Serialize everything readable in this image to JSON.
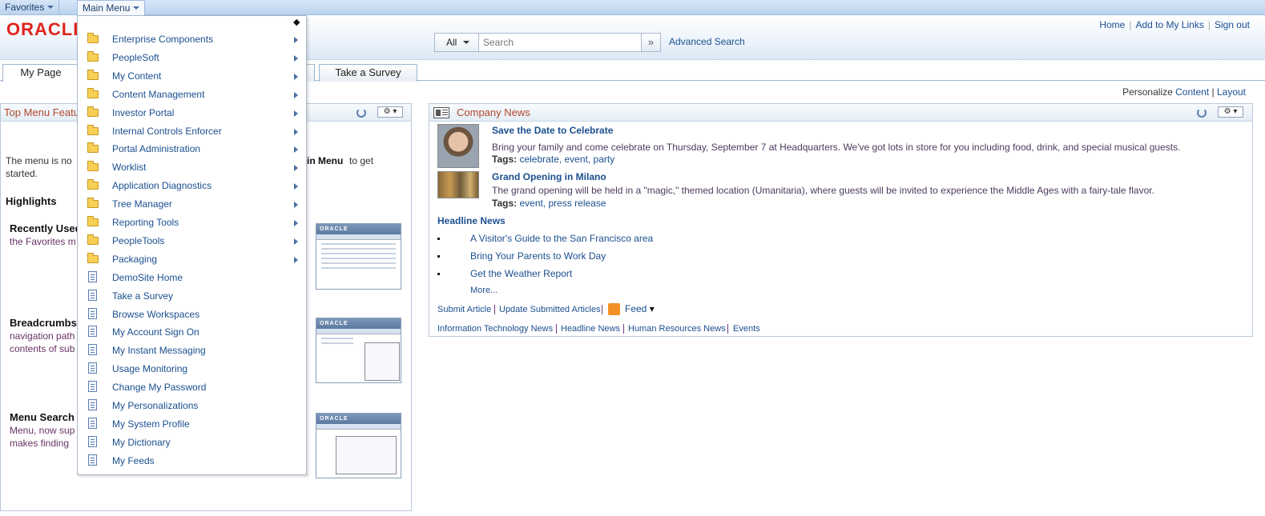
{
  "topnav": {
    "favorites": "Favorites",
    "main_menu": "Main Menu"
  },
  "header": {
    "logo": "ORACLE",
    "links": [
      "Home",
      "Add to My Links",
      "Sign out"
    ],
    "search": {
      "scope": "All",
      "placeholder": "Search",
      "advanced": "Advanced Search"
    }
  },
  "tabs": [
    {
      "label": "My Page",
      "active": true
    },
    {
      "label": "Take a Survey",
      "active": false
    }
  ],
  "personalize": {
    "label": "Personalize",
    "content": "Content",
    "sep": "|",
    "layout": "Layout"
  },
  "left_pagelet": {
    "title": "Top Menu Featu",
    "intro_a": "The menu is no",
    "intro_b": "in Menu",
    "intro_c": "to get",
    "intro_d": "started.",
    "highlights": "Highlights",
    "sections": [
      {
        "heading": "Recently Used",
        "lines": [
          "the Favorites m"
        ]
      },
      {
        "heading": "Breadcrumbs",
        "lines": [
          "navigation path",
          "contents of sub"
        ]
      },
      {
        "heading": "Menu Search",
        "lines": [
          "Menu, now sup",
          "makes finding"
        ]
      }
    ],
    "thumb_logo": "ORACLE"
  },
  "company_news": {
    "title": "Company News",
    "articles": [
      {
        "title": "Save the Date to Celebrate",
        "body": "Bring your family and come celebrate on Thursday, September 7 at Headquarters. We've got lots in store for you including food, drink, and special musical guests.",
        "tags_label": "Tags:",
        "tags": "celebrate, event, party"
      },
      {
        "title": "Grand Opening in Milano",
        "body": "The grand opening will be held in a \"magic,\" themed location (Umanitaria), where guests will be invited to experience the Middle Ages with a fairy-tale flavor.",
        "tags_label": "Tags:",
        "tags": "event, press release"
      }
    ],
    "headline_title": "Headline News",
    "headlines": [
      "A Visitor's Guide to the San Francisco area",
      "Bring Your Parents to Work Day",
      "Get the Weather Report"
    ],
    "more": "More...",
    "actions": [
      "Submit Article",
      "Update Submitted Articles"
    ],
    "feed": "Feed",
    "categories": [
      "Information Technology News",
      "Headline News",
      "Human Resources News",
      "Events"
    ]
  },
  "main_menu_items": [
    {
      "label": "Enterprise Components",
      "type": "folder"
    },
    {
      "label": "PeopleSoft",
      "type": "folder"
    },
    {
      "label": "My Content",
      "type": "folder"
    },
    {
      "label": "Content Management",
      "type": "folder"
    },
    {
      "label": "Investor Portal",
      "type": "folder"
    },
    {
      "label": "Internal Controls Enforcer",
      "type": "folder"
    },
    {
      "label": "Portal Administration",
      "type": "folder"
    },
    {
      "label": "Worklist",
      "type": "folder"
    },
    {
      "label": "Application Diagnostics",
      "type": "folder"
    },
    {
      "label": "Tree Manager",
      "type": "folder"
    },
    {
      "label": "Reporting Tools",
      "type": "folder"
    },
    {
      "label": "PeopleTools",
      "type": "folder"
    },
    {
      "label": "Packaging",
      "type": "folder"
    },
    {
      "label": "DemoSite Home",
      "type": "page"
    },
    {
      "label": "Take a Survey",
      "type": "page"
    },
    {
      "label": "Browse Workspaces",
      "type": "page"
    },
    {
      "label": "My Account Sign On",
      "type": "page"
    },
    {
      "label": "My Instant Messaging",
      "type": "page"
    },
    {
      "label": "Usage Monitoring",
      "type": "page"
    },
    {
      "label": "Change My Password",
      "type": "page"
    },
    {
      "label": "My Personalizations",
      "type": "page"
    },
    {
      "label": "My System Profile",
      "type": "page"
    },
    {
      "label": "My Dictionary",
      "type": "page"
    },
    {
      "label": "My Feeds",
      "type": "page"
    }
  ],
  "colors": {
    "accent_link": "#1b4f8f",
    "oracle_red": "#e0241b",
    "pagelet_title": "#b0492a"
  }
}
